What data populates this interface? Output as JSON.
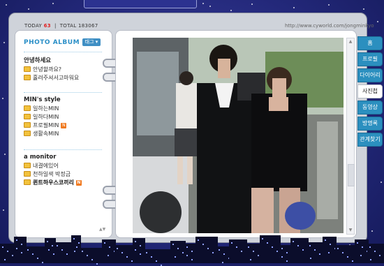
{
  "counter": {
    "today_label": "TODAY",
    "today_value": "63",
    "total_label": "TOTAL",
    "total_value": "183067"
  },
  "url": "http://www.cyworld.com/jongminkyo",
  "album": {
    "title": "PHOTO ALBUM",
    "button_label": "태그"
  },
  "folders": [
    {
      "title": "안녕하세요",
      "items": [
        {
          "label": "안녕할까요?",
          "bold": false,
          "new": false
        },
        {
          "label": "홀려주셔서고마워요",
          "bold": false,
          "new": false
        }
      ]
    },
    {
      "title": "MIN's style",
      "items": [
        {
          "label": "일하는MIN",
          "bold": false,
          "new": false
        },
        {
          "label": "일하다MIN",
          "bold": false,
          "new": false
        },
        {
          "label": "프로필MIN",
          "bold": false,
          "new": true
        },
        {
          "label": "생활속MIN",
          "bold": false,
          "new": false
        }
      ]
    },
    {
      "title": "a monitor",
      "items": [
        {
          "label": "내결에있어",
          "bold": false,
          "new": false
        },
        {
          "label": "천하일색 박정금",
          "bold": false,
          "new": false
        },
        {
          "label": "퀸트하우스코끼리",
          "bold": true,
          "new": true
        }
      ]
    }
  ],
  "new_badge": "N",
  "tabs": [
    "홈",
    "프로필",
    "다이어리",
    "사진첩",
    "동영상",
    "방명록",
    "관계찾기"
  ],
  "active_tab": "사진첩",
  "photo": {
    "description": "photo"
  },
  "colors": {
    "accent": "#2b8fbf",
    "sky": "#23287a",
    "album_title": "#2a8fc7"
  }
}
